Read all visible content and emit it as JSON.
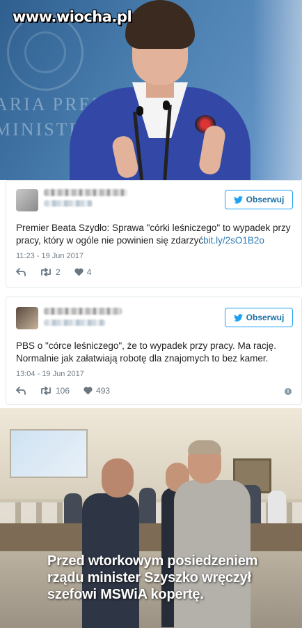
{
  "watermark": "www.wiocha.pl",
  "photo_top": {
    "background_text_line1": "ARIA PREZES",
    "background_text_line2": "MINISTRÓW"
  },
  "tweets": [
    {
      "follow_label": "Obserwuj",
      "text": "Premier Beata Szydło: Sprawa \"córki leśniczego\" to wypadek przy pracy, który w ogóle nie powinien się zdarzyć",
      "link": "bit.ly/2sO1B2o",
      "time": "11:23 - 19 Jun 2017",
      "retweets": "2",
      "likes": "4"
    },
    {
      "follow_label": "Obserwuj",
      "text": "PBS o \"córce leśniczego\", że to wypadek przy pracy. Ma rację. Normalnie jak załatwiają robotę dla znajomych to bez kamer.",
      "link": "",
      "time": "13:04 - 19 Jun 2017",
      "retweets": "106",
      "likes": "493"
    }
  ],
  "photo_bottom": {
    "caption_line1": "Przed wtorkowym posiedzeniem",
    "caption_line2": "rządu minister Szyszko wręczył",
    "caption_line3": "szefowi MSWiA kopertę."
  },
  "colors": {
    "twitter_blue": "#1da1f2",
    "link_blue": "#2b7bb9",
    "jacket_blue": "#3348a6"
  },
  "icons": [
    "twitter-bird-icon",
    "reply-icon",
    "retweet-icon",
    "heart-icon",
    "info-icon"
  ]
}
